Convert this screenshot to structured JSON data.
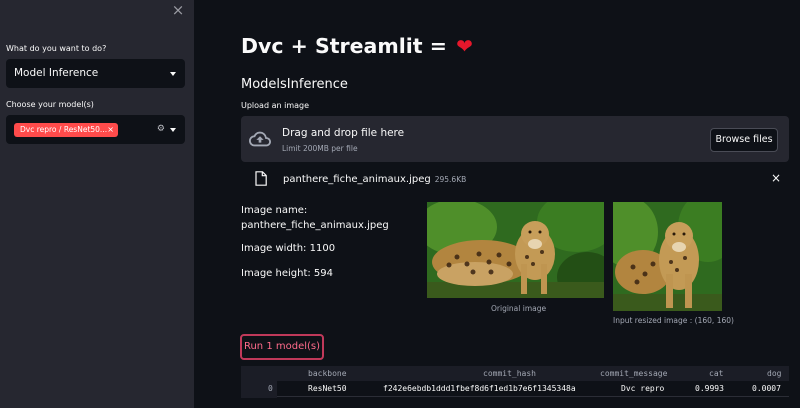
{
  "sidebar": {
    "close_label": "×",
    "task_label": "What do you want to do?",
    "task_value": "Model Inference",
    "model_label": "Choose your model(s)",
    "model_tag": "Dvc repro / ResNet50...",
    "tag_remove": "×",
    "clear_glyph": "⚙"
  },
  "main": {
    "title": "Dvc + Streamlit =",
    "heart": "❤",
    "subheader": "ModelsInference",
    "upload_label": "Upload an image",
    "dropzone_title": "Drag and drop file here",
    "dropzone_sub": "Limit 200MB per file",
    "browse_label": "Browse files",
    "file_name": "panthere_fiche_animaux.jpeg",
    "file_size": "295.6KB",
    "file_close": "×",
    "image_name_label": "Image name:",
    "image_name_value": "panthere_fiche_animaux.jpeg",
    "image_width": "Image width: 1100",
    "image_height": "Image height: 594",
    "caption_original": "Original image",
    "caption_resized": "Input resized image : (160, 160)",
    "run_label": "Run 1 model(s)"
  },
  "table": {
    "headers": [
      "backbone",
      "commit_hash",
      "commit_message",
      "cat",
      "dog"
    ],
    "rows": [
      {
        "index": "0",
        "backbone": "ResNet50",
        "commit_hash": "f242e6ebdb1ddd1fbef8d6f1ed1b7e6f1345348a",
        "commit_message": "Dvc repro",
        "cat": "0.9993",
        "dog": "0.0007"
      }
    ]
  },
  "colors": {
    "accent": "#ff4b4b",
    "background": "#0e1117",
    "sidebar": "#262730",
    "run_border": "#c0395a"
  }
}
